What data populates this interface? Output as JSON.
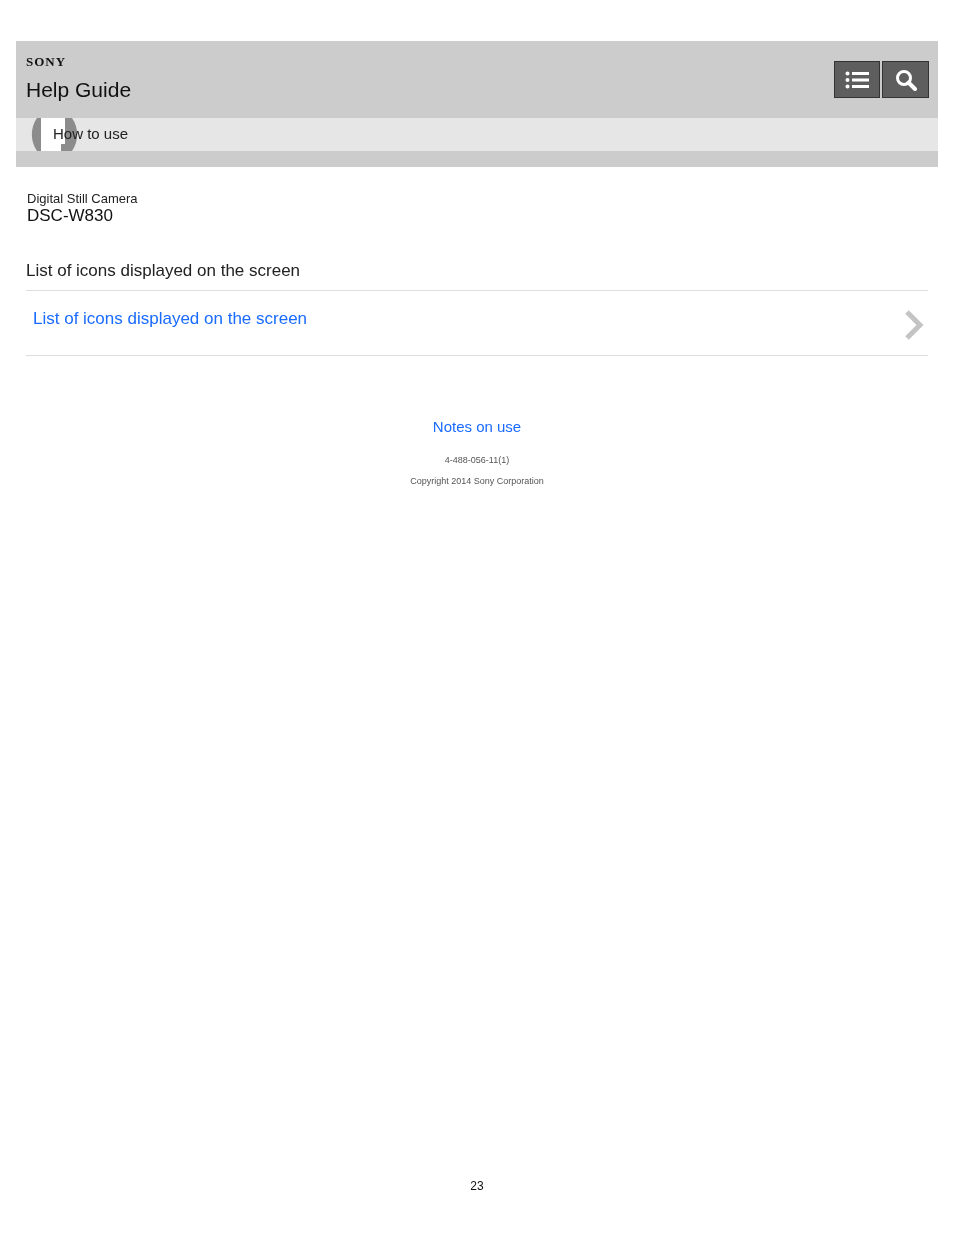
{
  "header": {
    "brand": "SONY",
    "title": "Help Guide",
    "breadcrumb": "How to use"
  },
  "product": {
    "category": "Digital Still Camera",
    "model": "DSC-W830"
  },
  "section": {
    "heading": "List of icons displayed on the screen",
    "links": [
      {
        "label": "List of icons displayed on the screen"
      }
    ]
  },
  "footer": {
    "link": "Notes on use",
    "code": "4-488-056-11(1)",
    "copyright": "Copyright 2014 Sony Corporation"
  },
  "page_number": "23"
}
